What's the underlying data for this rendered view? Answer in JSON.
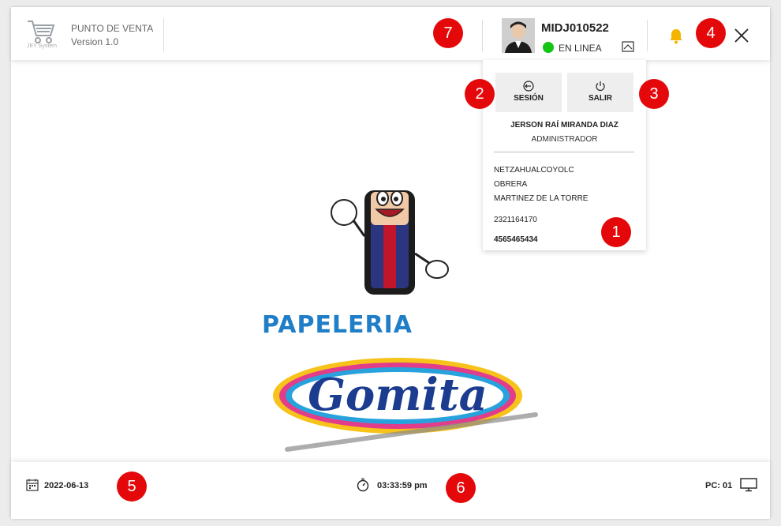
{
  "header": {
    "brand_small": "JEY System",
    "app_name": "PUNTO DE VENTA",
    "app_version": "Version 1.0",
    "user_id": "MIDJ010522",
    "status": "EN LINEA"
  },
  "badges": [
    "1",
    "2",
    "3",
    "4",
    "5",
    "6",
    "7"
  ],
  "dropdown": {
    "session_label": "SESIÓN",
    "exit_label": "SALIR",
    "full_name": "JERSON RAÍ MIRANDA DIAZ",
    "role": "ADMINISTRADOR",
    "address_1": "NETZAHUALCOYOLC",
    "address_2": "OBRERA",
    "address_3": "MARTINEZ DE LA TORRE",
    "phone": "2321164170",
    "code": "4565465434"
  },
  "logo": {
    "line1": "PAPELERIA",
    "line2": "Gomita"
  },
  "footer": {
    "date": "2022-06-13",
    "time": "03:33:59 pm",
    "pc": "PC: 01"
  },
  "colors": {
    "badge": "#e4080a",
    "status_online": "#14c514",
    "bell": "#f4b400",
    "brand_blue": "#1f7ec7"
  },
  "icons": [
    "cart-icon",
    "bell-icon",
    "close-icon",
    "collapse-icon",
    "session-icon",
    "power-icon",
    "calendar-icon",
    "stopwatch-icon",
    "monitor-icon"
  ]
}
